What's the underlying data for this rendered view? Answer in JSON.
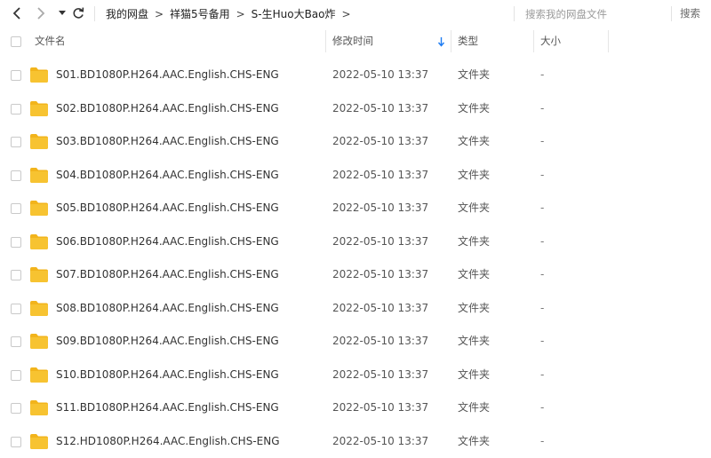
{
  "toolbar": {
    "back_icon": "chevron-left-icon",
    "forward_icon": "chevron-right-icon",
    "history_icon": "caret-down-icon",
    "refresh_icon": "refresh-icon"
  },
  "breadcrumb": {
    "items": [
      "我的网盘",
      "祥猫5号备用",
      "S-生Huo大Bao炸"
    ],
    "separator": ">"
  },
  "search": {
    "placeholder": "搜索我的网盘文件",
    "button_label": "搜索"
  },
  "columns": {
    "name": "文件名",
    "modified": "修改时间",
    "type": "类型",
    "size": "大小",
    "sort_icon": "arrow-down-icon"
  },
  "files": [
    {
      "name": "S01.BD1080P.H264.AAC.English.CHS-ENG",
      "modified": "2022-05-10 13:37",
      "type": "文件夹",
      "size": "-"
    },
    {
      "name": "S02.BD1080P.H264.AAC.English.CHS-ENG",
      "modified": "2022-05-10 13:37",
      "type": "文件夹",
      "size": "-"
    },
    {
      "name": "S03.BD1080P.H264.AAC.English.CHS-ENG",
      "modified": "2022-05-10 13:37",
      "type": "文件夹",
      "size": "-"
    },
    {
      "name": "S04.BD1080P.H264.AAC.English.CHS-ENG",
      "modified": "2022-05-10 13:37",
      "type": "文件夹",
      "size": "-"
    },
    {
      "name": "S05.BD1080P.H264.AAC.English.CHS-ENG",
      "modified": "2022-05-10 13:37",
      "type": "文件夹",
      "size": "-"
    },
    {
      "name": "S06.BD1080P.H264.AAC.English.CHS-ENG",
      "modified": "2022-05-10 13:37",
      "type": "文件夹",
      "size": "-"
    },
    {
      "name": "S07.BD1080P.H264.AAC.English.CHS-ENG",
      "modified": "2022-05-10 13:37",
      "type": "文件夹",
      "size": "-"
    },
    {
      "name": "S08.BD1080P.H264.AAC.English.CHS-ENG",
      "modified": "2022-05-10 13:37",
      "type": "文件夹",
      "size": "-"
    },
    {
      "name": "S09.BD1080P.H264.AAC.English.CHS-ENG",
      "modified": "2022-05-10 13:37",
      "type": "文件夹",
      "size": "-"
    },
    {
      "name": "S10.BD1080P.H264.AAC.English.CHS-ENG",
      "modified": "2022-05-10 13:37",
      "type": "文件夹",
      "size": "-"
    },
    {
      "name": "S11.BD1080P.H264.AAC.English.CHS-ENG",
      "modified": "2022-05-10 13:37",
      "type": "文件夹",
      "size": "-"
    },
    {
      "name": "S12.HD1080P.H264.AAC.English.CHS-ENG",
      "modified": "2022-05-10 13:37",
      "type": "文件夹",
      "size": "-"
    }
  ],
  "colors": {
    "folder": "#f7c331",
    "folder_tab": "#f2b41c",
    "sort_arrow": "#1e7cf2"
  }
}
